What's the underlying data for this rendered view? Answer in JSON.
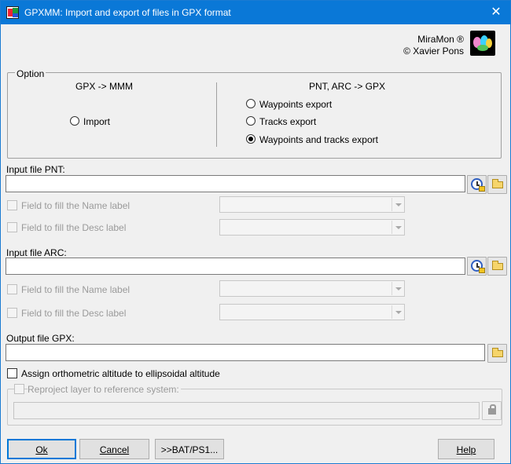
{
  "window": {
    "title": "GPXMM: Import and export of files in GPX format",
    "close_glyph": "✕"
  },
  "credit": {
    "product": "MiraMon ®",
    "author": "© Xavier Pons"
  },
  "option_group": {
    "legend": "Option",
    "left_heading": "GPX -> MMM",
    "right_heading": "PNT, ARC -> GPX",
    "radios": [
      {
        "label": "Import",
        "checked": false
      },
      {
        "label": "Waypoints export",
        "checked": false
      },
      {
        "label": "Tracks export",
        "checked": false
      },
      {
        "label": "Waypoints and tracks export",
        "checked": true
      }
    ]
  },
  "pnt_section": {
    "label": "Input file PNT:",
    "value": "",
    "name_field_label": "Field to fill the Name label",
    "desc_field_label": "Field to fill the Desc label"
  },
  "arc_section": {
    "label": "Input file ARC:",
    "value": "",
    "name_field_label": "Field to fill the Name label",
    "desc_field_label": "Field to fill the Desc label"
  },
  "gpx_section": {
    "label": "Output file GPX:",
    "value": ""
  },
  "assign_altitude_label": "Assign orthometric altitude to ellipsoidal altitude",
  "reproject_label": "Reproject layer to reference system:",
  "reproject_value": "",
  "buttons": {
    "ok": "Ok",
    "cancel": "Cancel",
    "bat": ">>BAT/PS1...",
    "help": "Help"
  },
  "icons": {
    "app": "gpxmm-app-icon",
    "recent": "clock-recent-icon",
    "browse": "folder-open-icon",
    "lock": "lock-icon"
  }
}
